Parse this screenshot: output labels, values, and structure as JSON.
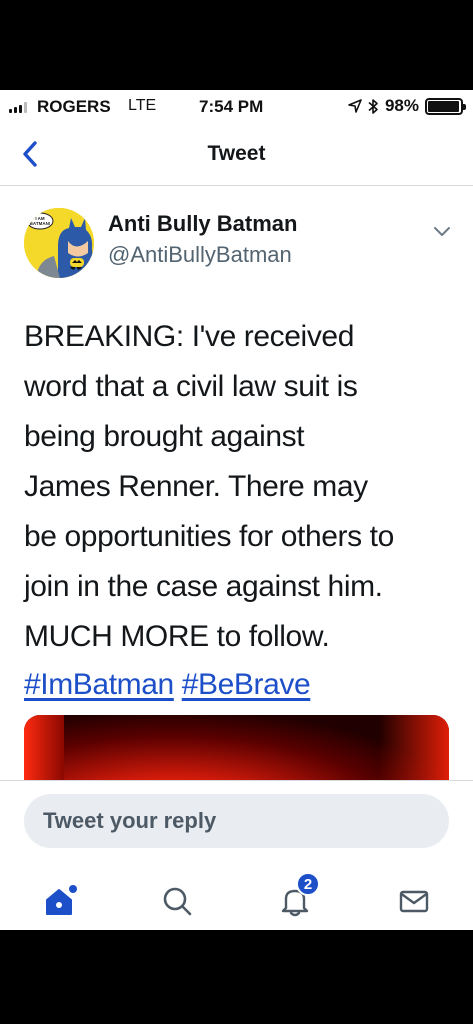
{
  "status_bar": {
    "carrier": "ROGERS",
    "network": "LTE",
    "time": "7:54 PM",
    "battery": "98%",
    "battery_level": 0.98,
    "icons": [
      "signal-icon",
      "location-arrow-icon",
      "bluetooth-icon",
      "battery-icon"
    ]
  },
  "nav": {
    "title": "Tweet",
    "back_icon": "chevron-left-icon"
  },
  "tweet": {
    "author_name": "Anti Bully Batman",
    "author_handle": "@AntiBullyBatman",
    "avatar_caption": "I AM BATMAN!",
    "text_lines": [
      "BREAKING: I've received",
      "word that a civil law suit is",
      "being brought against",
      "James Renner. There may",
      "be opportunities for others to",
      "join in the case against him.",
      "MUCH MORE to follow."
    ],
    "hashtags": [
      "#ImBatman",
      "#BeBrave"
    ]
  },
  "reply": {
    "placeholder": "Tweet your reply"
  },
  "tab_bar": {
    "items": [
      "home-icon",
      "search-icon",
      "notifications-icon",
      "messages-icon"
    ],
    "notification_count": "2"
  },
  "colors": {
    "accent": "#1d4fc9",
    "text": "#14171a",
    "secondary": "#536471"
  }
}
